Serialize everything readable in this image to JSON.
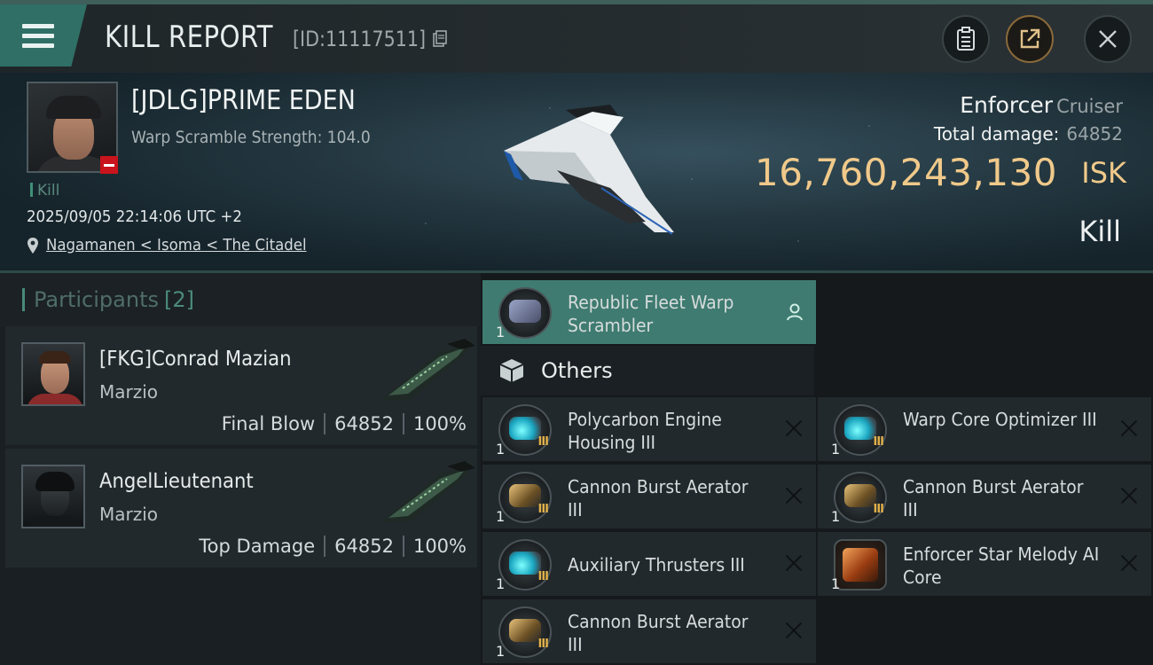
{
  "header": {
    "title": "KILL REPORT",
    "report_id": "[ID:11117511]",
    "buttons": [
      "clipboard-icon",
      "share-icon",
      "close-icon"
    ]
  },
  "victim": {
    "name": "[JDLG]PRIME EDEN",
    "warp_scramble": "Warp Scramble Strength: 104.0",
    "kill_tag": "Kill",
    "datetime": "2025/09/05 22:14:06 UTC +2",
    "location": "Nagamanen < Isoma < The Citadel",
    "ship_name": "Enforcer",
    "ship_class": "Cruiser",
    "total_damage_label": "Total damage:",
    "total_damage": "64852",
    "isk_value": "16,760,243,130",
    "isk_unit": "ISK",
    "result": "Kill"
  },
  "participants": {
    "label": "Participants",
    "count": "[2]",
    "items": [
      {
        "name": "[FKG]Conrad Mazian",
        "corp": "Marzio",
        "role": "Final Blow",
        "damage": "64852",
        "percent": "100%"
      },
      {
        "name": "AngelLieutenant",
        "corp": "Marzio",
        "role": "Top Damage",
        "damage": "64852",
        "percent": "100%"
      }
    ]
  },
  "modules": {
    "highlighted": {
      "qty": "1",
      "name": "Republic Fleet Warp Scrambler"
    },
    "others_label": "Others",
    "items": [
      {
        "qty": "1",
        "name": "Polycarbon Engine Housing III",
        "tier": "III",
        "kind": "cyan"
      },
      {
        "qty": "1",
        "name": "Warp Core Optimizer III",
        "tier": "III",
        "kind": "cyan"
      },
      {
        "qty": "1",
        "name": "Cannon Burst Aerator III",
        "tier": "III",
        "kind": "gold"
      },
      {
        "qty": "1",
        "name": "Cannon Burst Aerator III",
        "tier": "III",
        "kind": "gold"
      },
      {
        "qty": "1",
        "name": "Auxiliary Thrusters III",
        "tier": "III",
        "kind": "cyan"
      },
      {
        "qty": "1",
        "name": "Enforcer Star Melody AI Core",
        "tier": "",
        "kind": "orange"
      },
      {
        "qty": "1",
        "name": "Cannon Burst Aerator III",
        "tier": "III",
        "kind": "gold"
      }
    ]
  },
  "colors": {
    "accent": "#3f7b70",
    "isk": "#f0c98a",
    "loss_badge": "#c8141c"
  }
}
